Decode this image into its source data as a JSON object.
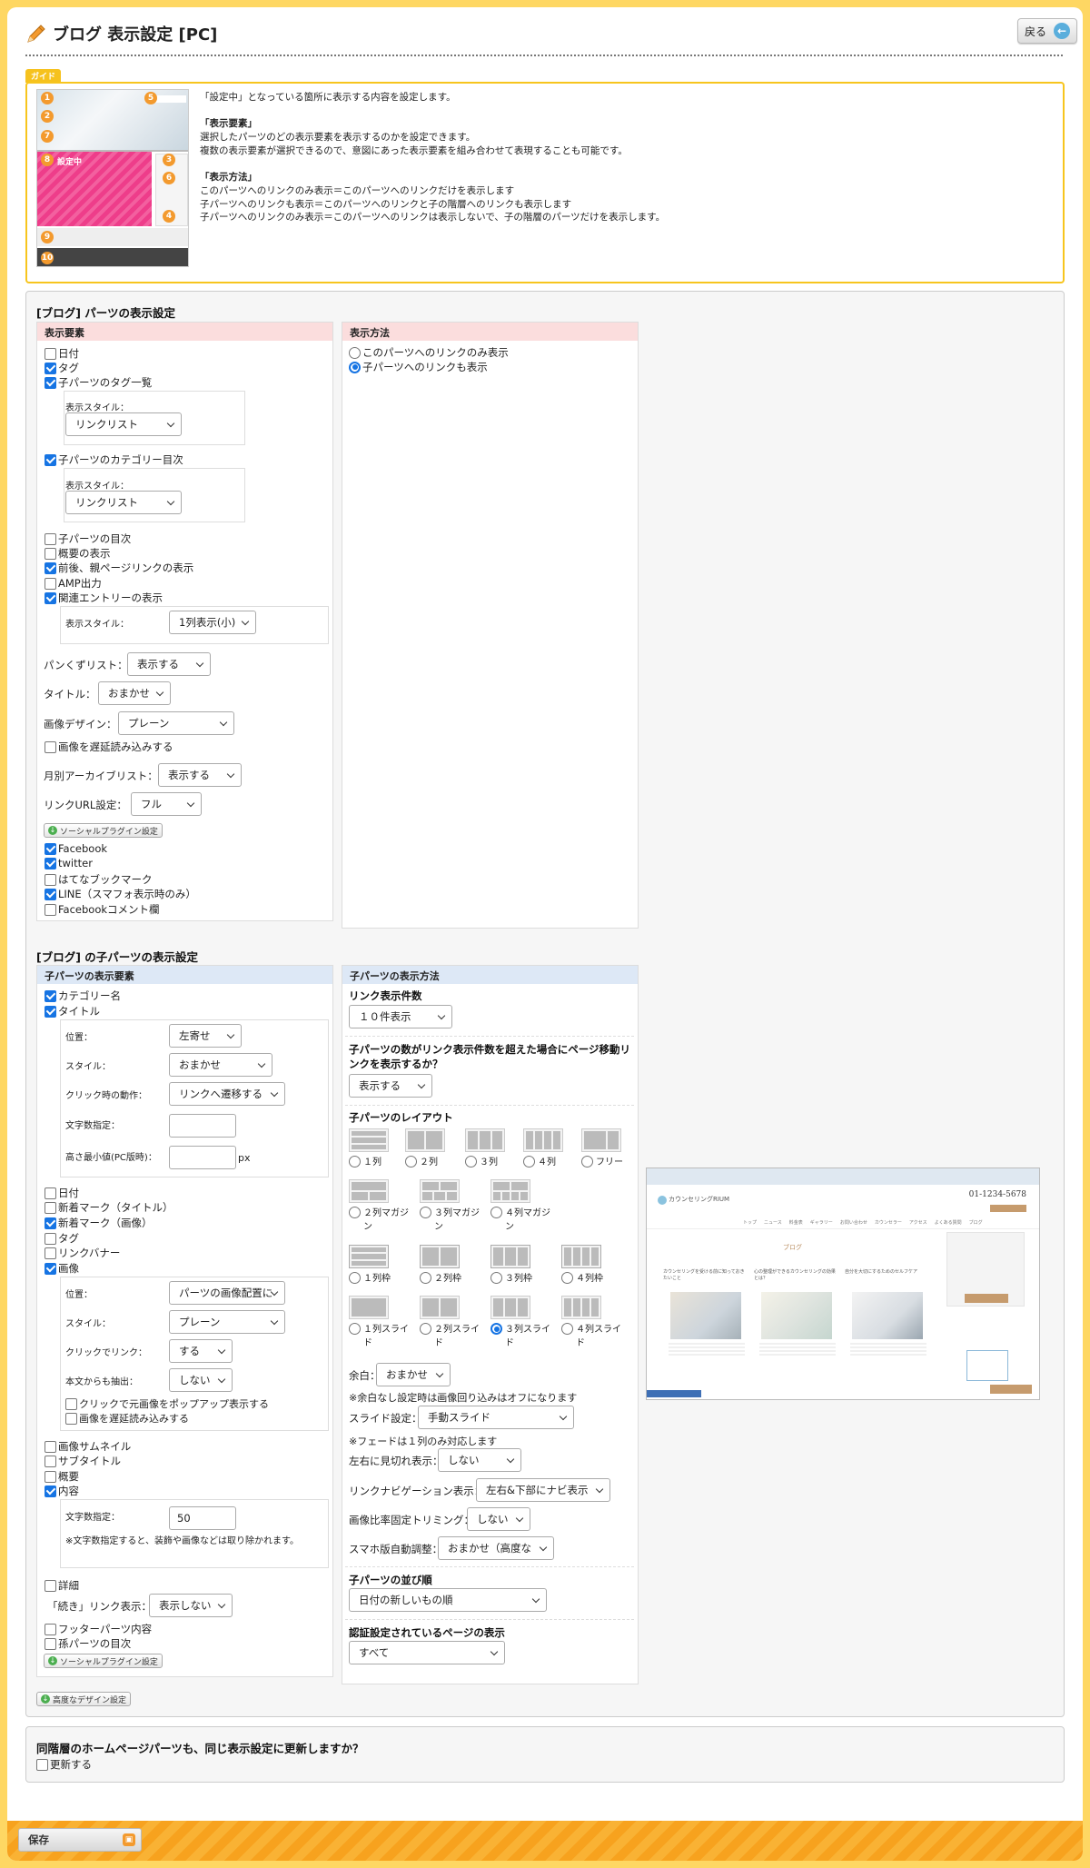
{
  "header": {
    "title": "ブログ 表示設定 [PC]",
    "back_label": "戻る"
  },
  "guide": {
    "tag": "ガイド",
    "intro": "「設定中」となっている箇所に表示する内容を設定します。",
    "elements_heading": "「表示要素」",
    "elements_line1": "選択したパーツのどの表示要素を表示するのかを設定できます。",
    "elements_line2": "複数の表示要素が選択できるので、意図にあった表示要素を組み合わせて表現することも可能です。",
    "method_heading": "「表示方法」",
    "method_line1": "このパーツへのリンクのみ表示＝このパーツへのリンクだけを表示します",
    "method_line2": "子パーツへのリンクも表示＝このパーツへのリンクと子の階層へのリンクも表示します",
    "method_line3": "子パーツへのリンクのみ表示＝このパーツへのリンクは表示しないで、子の階層のパーツだけを表示します。",
    "thumb_setting_label": "設定中"
  },
  "parts": {
    "section_title": "[ブログ] パーツの表示設定",
    "elements_header": "表示要素",
    "method_header": "表示方法",
    "date": "日付",
    "tag": "タグ",
    "tag_list": "子パーツのタグ一覧",
    "display_style_label": "表示スタイル：",
    "link_list": "リンクリスト",
    "category_toc": "子パーツのカテゴリー目次",
    "toc": "子パーツの目次",
    "summary": "概要の表示",
    "prev_next": "前後、親ページリンクの表示",
    "amp": "AMP出力",
    "related": "関連エントリーの表示",
    "related_style_value": "1列表示(小)",
    "breadcrumb_label": "パンくずリスト：",
    "breadcrumb_value": "表示する",
    "title_label": "タイトル：",
    "title_value": "おまかせ",
    "image_design_label": "画像デザイン：",
    "image_design_value": "プレーン",
    "lazy_load": "画像を遅延読み込みする",
    "monthly_label": "月別アーカイブリスト：",
    "monthly_value": "表示する",
    "link_url_label": "リンクURL設定：",
    "link_url_value": "フル",
    "social_button": "ソーシャルプラグイン設定",
    "facebook": "Facebook",
    "twitter": "twitter",
    "hatena": "はてなブックマーク",
    "line": "LINE（スマフォ表示時のみ）",
    "fb_comment": "Facebookコメント欄",
    "method_opt1": "このパーツへのリンクのみ表示",
    "method_opt2": "子パーツへのリンクも表示"
  },
  "child": {
    "section_title": "[ブログ] の子パーツの表示設定",
    "elements_header": "子パーツの表示要素",
    "method_header": "子パーツの表示方法",
    "category_name": "カテゴリー名",
    "title": "タイトル",
    "position_label": "位置：",
    "position_value": "左寄せ",
    "style_label": "スタイル：",
    "style_value": "おまかせ",
    "click_label": "クリック時の動作：",
    "click_value": "リンクへ遷移する",
    "char_label": "文字数指定：",
    "min_height_label": "高さ最小値(PC版時)：",
    "px": "px",
    "date": "日付",
    "new_title": "新着マーク（タイトル）",
    "new_image": "新着マーク（画像）",
    "tag": "タグ",
    "link_banner": "リンクバナー",
    "image": "画像",
    "img_position_label": "位置：",
    "img_position_value": "パーツの画像配置に",
    "img_style_label": "スタイル：",
    "img_style_value": "プレーン",
    "click_link_label": "クリックでリンク：",
    "click_link_value": "する",
    "extract_label": "本文からも抽出：",
    "extract_value": "しない",
    "popup": "クリックで元画像をポップアップ表示する",
    "lazy": "画像を遅延読み込みする",
    "thumbnail": "画像サムネイル",
    "subtitle": "サブタイトル",
    "summary": "概要",
    "content": "内容",
    "content_char_label": "文字数指定：",
    "content_char_value": "50",
    "content_note": "※文字数指定すると、装飾や画像などは取り除かれます。",
    "detail": "詳細",
    "continue_label": "「続き」リンク表示：",
    "continue_value": "表示しない",
    "footer_parts": "フッターパーツ内容",
    "grandchild": "孫パーツの目次",
    "social_button": "ソーシャルプラグイン設定",
    "link_count_label": "リンク表示件数",
    "link_count_value": "１０件表示",
    "paging_label": "子パーツの数がリンク表示件数を超えた場合にページ移動リンクを表示するか？",
    "paging_value": "表示する",
    "layout_label": "子パーツのレイアウト",
    "layouts": [
      "１列",
      "２列",
      "３列",
      "４列",
      "フリー",
      "２列マガジン",
      "３列マガジン",
      "４列マガジン",
      "１列枠",
      "２列枠",
      "３列枠",
      "４列枠",
      "１列スライド",
      "２列スライド",
      "３列スライド",
      "４列スライド"
    ],
    "margin_label": "余白：",
    "margin_value": "おまかせ",
    "margin_note": "※余白なし設定時は画像回り込みはオフになります",
    "slide_label": "スライド設定：",
    "slide_value": "手動スライド",
    "fade_note": "※フェードは１列のみ対応します",
    "peek_label": "左右に見切れ表示：",
    "peek_value": "しない",
    "link_nav_label": "リンクナビゲーション表示：",
    "link_nav_value": "左右&下部にナビ表示",
    "ratio_label": "画像比率固定トリミング：",
    "ratio_value": "しない",
    "sp_label": "スマホ版自動調整：",
    "sp_value": "おまかせ（高度な",
    "order_label": "子パーツの並び順",
    "order_value": "日付の新しいもの順",
    "auth_label": "認証設定されているページの表示",
    "auth_value": "すべて"
  },
  "preview": {
    "site_name": "カウンセリングRIUM",
    "phone": "01-1234-5678",
    "heading": "ブログ",
    "nav": [
      "トップ",
      "ニュース",
      "料金表",
      "ギャラリー",
      "お問い合わせ",
      "カウンセラー",
      "アクセス",
      "よくある質問",
      "ブログ"
    ],
    "cards": [
      "カウンセリングを受ける前に知っておきたいこと",
      "心の整理ができるカウンセリングの効果とは？",
      "自分を大切にするためのセルフケア"
    ]
  },
  "advanced_button": "高度なデザイン設定",
  "sync": {
    "question": "同階層のホームページパーツも、同じ表示設定に更新しますか？",
    "label": "更新する"
  },
  "save_label": "保存",
  "colors": {
    "accent": "#f6c21e",
    "stripe": "#f7a21e",
    "check": "#1674e3",
    "pink_header": "#fbdddd",
    "blue_header": "#dde8f6"
  }
}
